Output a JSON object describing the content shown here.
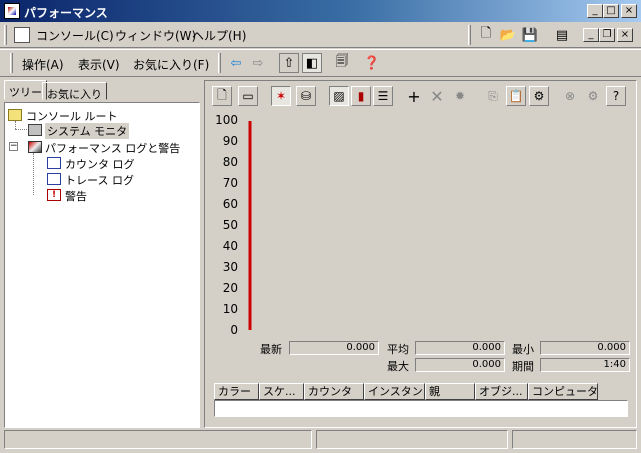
{
  "window": {
    "title": "パフォーマンス"
  },
  "menubar": {
    "items": [
      "コンソール(C)",
      "ウィンドウ(W)",
      "ヘルプ(H)"
    ]
  },
  "toolbar": {
    "items": [
      "操作(A)",
      "表示(V)",
      "お気に入り(F)"
    ]
  },
  "left_tabs": [
    "ツリー",
    "お気に入り"
  ],
  "tree": {
    "root": "コンソール ルート",
    "system_monitor": "システム モニタ",
    "perf_logs": "パフォーマンス ログと警告",
    "counter_logs": "カウンタ ログ",
    "trace_logs": "トレース ログ",
    "alerts": "警告"
  },
  "chart_data": {
    "type": "line",
    "ylim": [
      0,
      100
    ],
    "y_ticks": [
      "100",
      "90",
      "80",
      "70",
      "60",
      "50",
      "40",
      "30",
      "20",
      "10",
      "0"
    ],
    "time_bar_color": "#cc0000",
    "series": []
  },
  "stats": {
    "latest_label": "最新",
    "latest": "0.000",
    "average_label": "平均",
    "average": "0.000",
    "minimum_label": "最小",
    "minimum": "0.000",
    "maximum_label": "最大",
    "maximum": "0.000",
    "duration_label": "期間",
    "duration": "1:40"
  },
  "legend_columns": [
    "カラー",
    "スケ...",
    "カウンタ",
    "インスタン...",
    "親",
    "オブジ...",
    "コンピュータ"
  ]
}
